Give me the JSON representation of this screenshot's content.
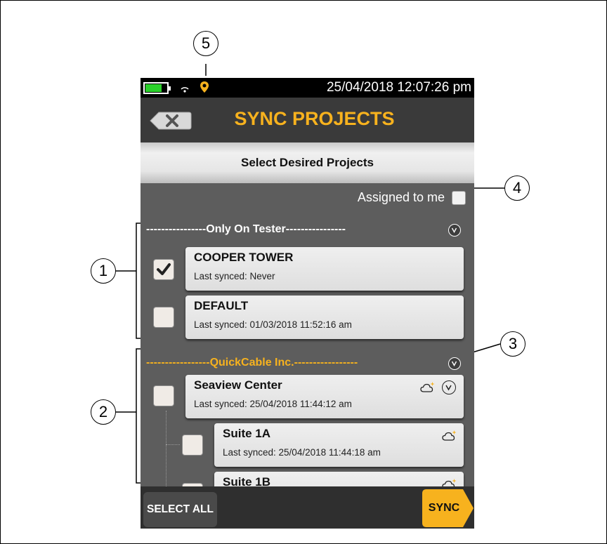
{
  "callouts": [
    "5",
    "4",
    "1",
    "3",
    "2"
  ],
  "status_bar": {
    "datetime": "25/04/2018 12:07:26 pm",
    "battery_level": 0.75,
    "battery_color": "#2bd12b"
  },
  "header": {
    "title": "SYNC PROJECTS",
    "back_icon": "close-back-icon"
  },
  "subheader": "Select Desired Projects",
  "filter": {
    "assigned_label": "Assigned to me",
    "assigned_checked": false
  },
  "groups": [
    {
      "header": "----------------Only On Tester----------------",
      "color": "#ffffff",
      "projects": [
        {
          "name": "COOPER TOWER",
          "last_synced": "Last synced: Never",
          "checked": true
        },
        {
          "name": "DEFAULT",
          "last_synced": "Last synced: 01/03/2018 11:52:16 am",
          "checked": false
        }
      ]
    },
    {
      "header": "-----------------QuickCable Inc.-----------------",
      "color": "#f7b21e",
      "projects": [
        {
          "name": "Seaview Center",
          "last_synced": "Last synced: 25/04/2018 11:44:12 am",
          "checked": false,
          "cloud": true,
          "expandable": true
        },
        {
          "name": "Suite 1A",
          "last_synced": "Last synced: 25/04/2018 11:44:18 am",
          "checked": false,
          "cloud": true
        },
        {
          "name": "Suite 1B",
          "last_synced": "",
          "checked": false,
          "cloud": true
        }
      ]
    }
  ],
  "footer": {
    "select_all": "SELECT ALL",
    "sync": "SYNC"
  },
  "colors": {
    "accent": "#f7b21e",
    "background": "#5d5d5d",
    "titlebar": "#3a3a3a"
  }
}
